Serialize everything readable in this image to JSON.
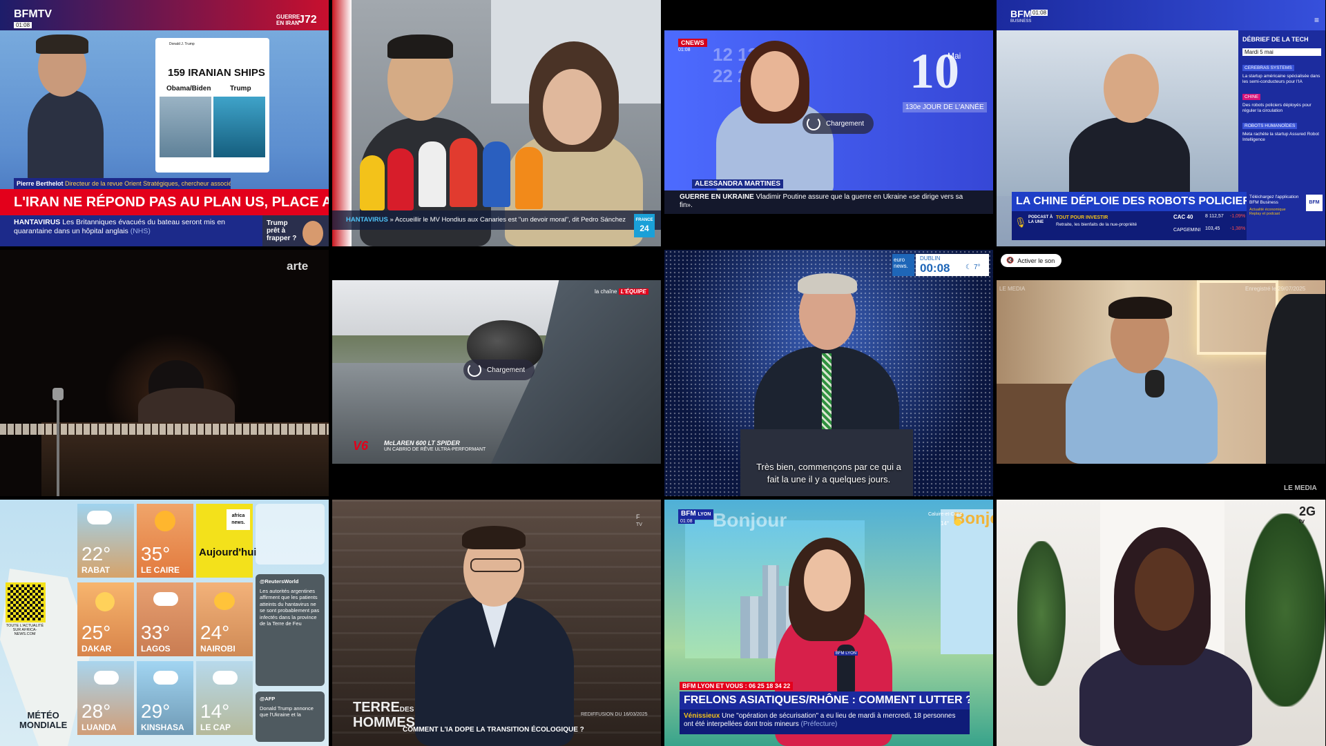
{
  "c1": {
    "logo": "BFMTV",
    "clock": "01:08",
    "badge_line1": "GUERRE",
    "badge_line2": "EN IRAN",
    "badge_day": "J72",
    "tweet_author": "Donald J. Trump",
    "tweet_title": "159 IRANIAN SHIPS",
    "tweet_left": "Obama/Biden",
    "tweet_right": "Trump",
    "guest_name": "Pierre Berthelot",
    "guest_title": "Directeur de la revue Orient Stratégiques, chercheur associé à l'IPSE",
    "headline": "L'IRAN NE RÉPOND PAS AU PLAN US, PLACE AUX FRAPPES ?",
    "ticker_label": "HANTAVIRUS",
    "ticker_text": "Les Britanniques évacués du bateau seront mis en quarantaine dans un hôpital anglais",
    "ticker_source": "(NHS)",
    "promo": "Trump prêt à frapper ?"
  },
  "c2": {
    "ticker_label": "HANTAVIRUS",
    "ticker_text": "» Accueillir le MV Hondius aux Canaries est \"un devoir moral\", dit Pedro Sánchez",
    "logo_line1": "FRANCE",
    "logo_line2": "24"
  },
  "c3": {
    "logo": "CNEWS",
    "clock": "01:08",
    "date_month": "Mai",
    "date_day": "10",
    "date_sub": "130e JOUR DE L'ANNÉE",
    "loading": "Chargement",
    "anchor": "ALESSANDRA MARTINES",
    "ticker_label": "GUERRE EN UKRAINE",
    "ticker_text": "Vladimir Poutine assure que la guerre en Ukraine «se dirige vers sa fin»."
  },
  "c4": {
    "logo": "BFM",
    "logo_sub": "BUSINESS",
    "clock": "01:08",
    "side_title": "DÉBRIEF DE LA TECH",
    "side_date": "Mardi 5 mai",
    "side_items": [
      {
        "tag": "CEREBRAS SYSTEMS",
        "text": "La startup américaine spécialisée dans les semi-conducteurs pour l'IA"
      },
      {
        "tag": "CHINE",
        "text": "Des robots policiers déployés pour réguler la circulation"
      },
      {
        "tag": "ROBOTS HUMANOÏDES",
        "text": "Meta rachète la startup Assured Robot Intelligence"
      }
    ],
    "headline": "LA CHINE DÉPLOIE DES ROBOTS POLICIERS",
    "podcast_label": "PODCAST À LA UNE",
    "podcast_title": "TOUT POUR INVESTIR",
    "podcast_text": "Retraite, les bienfaits de la nue-propriété",
    "stocks": [
      {
        "name": "CAC 40",
        "value": "8 112,57",
        "change": "-1,09%"
      },
      {
        "name": "CAPGEMINI",
        "value": "103,45",
        "change": "-1,38%"
      }
    ],
    "app_text": "Téléchargez l'application BFM Business",
    "app_sub1": "Actualité économique",
    "app_sub2": "Replay et podcast"
  },
  "c5": {
    "logo": "arte"
  },
  "c6": {
    "channel_prefix": "la chaîne",
    "channel": "L'ÉQUIPE",
    "loading": "Chargement",
    "model": "McLAREN 600 LT SPIDER",
    "tagline": "UN CABRIO DE RÊVE ULTRA-PERFORMANT"
  },
  "c7": {
    "logo_line1": "euro",
    "logo_line2": "news.",
    "city": "DUBLIN",
    "time": "00:08",
    "weather": "7°",
    "subtitle_line1": "Très bien, commençons par ce qui a",
    "subtitle_line2": "fait la une il y a quelques jours."
  },
  "c8": {
    "sound_button": "Activer le son",
    "watermark": "Enregistré le 29/07/2025",
    "logo": "LE MEDIA"
  },
  "c9": {
    "cities": [
      {
        "temp": "22°",
        "name": "RABAT"
      },
      {
        "temp": "35°",
        "name": "LE CAIRE"
      },
      {
        "temp": "25°",
        "name": "DAKAR"
      },
      {
        "temp": "33°",
        "name": "LAGOS"
      },
      {
        "temp": "24°",
        "name": "NAIROBI"
      },
      {
        "temp": "28°",
        "name": "LUANDA"
      },
      {
        "temp": "29°",
        "name": "KINSHASA"
      },
      {
        "temp": "14°",
        "name": "LE CAP"
      }
    ],
    "today_label": "Aujourd'hui",
    "logo_line1": "africa",
    "logo_line2": "news.",
    "qr_caption": "TOUTE L'ACTUALITÉ SUR AFRICA-NEWS.COM",
    "meteo_line1": "MÉTÉO",
    "meteo_line2": "MONDIALE",
    "feed": [
      {
        "handle": "@ReutersWorld",
        "text": "Les autorités argentines affirment que les patients atteints du hantavirus ne se sont probablement pas infectés dans la province de la Terre de Feu"
      },
      {
        "handle": "@AFP",
        "text": "Donald Trump annonce que l'Ukraine et la"
      }
    ]
  },
  "c10": {
    "show_line1": "TERRE",
    "show_des": "DES",
    "show_line2": "HOMMES",
    "title": "COMMENT L'IA DOPE LA TRANSITION ÉCOLOGIQUE ?",
    "rebroadcast": "REDIFFUSION DU 16/03/2025",
    "logo": "TV"
  },
  "c11": {
    "logo": "BFM",
    "logo_sub": "LYON",
    "clock": "01:08",
    "set_text": "Bonjour",
    "location": "Caluire-et-Cuire",
    "location_temp": "14°",
    "phone_bar": "BFM LYON ET VOUS : 06 25 18 34 22",
    "headline": "FRELONS ASIATIQUES/RHÔNE : COMMENT LUTTER ?",
    "ticker_label": "Vénissieux",
    "ticker_text": "Une \"opération de sécurisation\" a eu lieu de mardi à mercredi, 18 personnes ont été interpellées dont trois mineurs",
    "ticker_source": "(Préfecture)",
    "mic": "BFM LYON"
  },
  "c12": {
    "logo_line1": "2G",
    "logo_line2": "tv"
  },
  "colors": {
    "bfm_red": "#e3001b",
    "bfm_blue": "#1c2a8a",
    "cnews_blue": "#3a55e6",
    "bfm_business_blue": "#1f3fc7",
    "africa_yellow": "#f3e11b"
  }
}
